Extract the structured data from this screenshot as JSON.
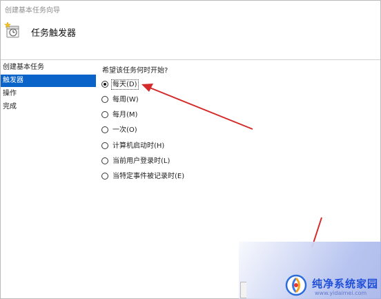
{
  "window": {
    "title": "创建基本任务向导"
  },
  "header": {
    "title": "任务触发器",
    "icon": "task-clock-icon"
  },
  "sidebar": {
    "items": [
      {
        "label": "创建基本任务",
        "active": false
      },
      {
        "label": "触发器",
        "active": true
      },
      {
        "label": "操作",
        "active": false
      },
      {
        "label": "完成",
        "active": false
      }
    ]
  },
  "main": {
    "question": "希望该任务何时开始?",
    "selected": "每天(D)",
    "options": [
      {
        "label": "每天(D)",
        "checked": true
      },
      {
        "label": "每周(W)",
        "checked": false
      },
      {
        "label": "每月(M)",
        "checked": false
      },
      {
        "label": "一次(O)",
        "checked": false
      },
      {
        "label": "计算机启动时(H)",
        "checked": false
      },
      {
        "label": "当前用户登录时(L)",
        "checked": false
      },
      {
        "label": "当特定事件被记录时(E)",
        "checked": false
      }
    ]
  },
  "annotations": {
    "arrow_color": "#d42a2a"
  },
  "watermark": {
    "brand": "纯净系统家园",
    "url": "www.yidaimei.com"
  },
  "colors": {
    "accent": "#0a63c9",
    "arrow": "#d42a2a"
  }
}
